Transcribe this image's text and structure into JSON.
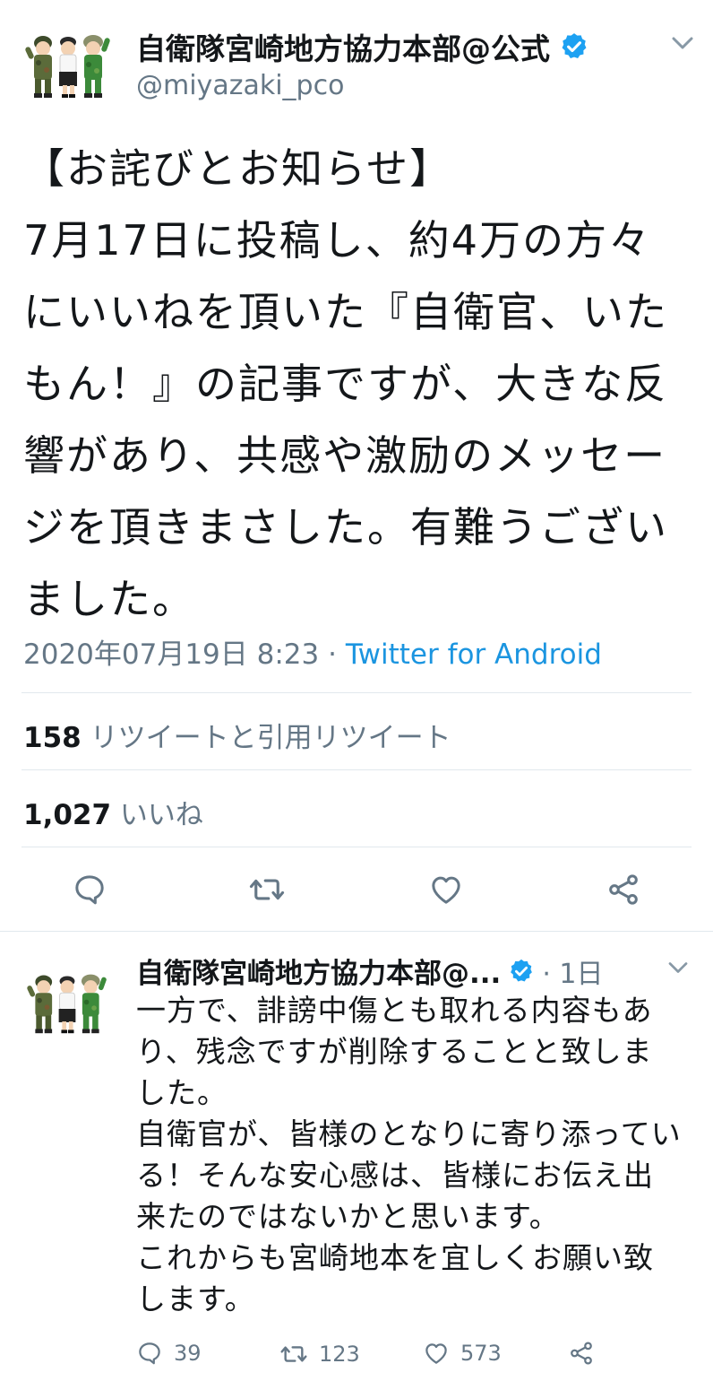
{
  "tweet": {
    "display_name": "自衛隊宮崎地方協力本部@公式",
    "handle": "@miyazaki_pco",
    "text": "【お詫びとお知らせ】\n7月17日に投稿し、約4万の方々にいいねを頂いた『自衛官、いたもん！』の記事ですが、大きな反響があり、共感や激励のメッセージを頂きまさした。有難うございました。",
    "timestamp": "2020年07月19日 8:23",
    "separator": " · ",
    "source": "Twitter for Android",
    "retweets_count": "158",
    "retweets_label": "リツイートと引用リツイート",
    "likes_count": "1,027",
    "likes_label": "いいね"
  },
  "reply": {
    "display_name": "自衛隊宮崎地方協力本部@...",
    "time": "· 1日",
    "text": "一方で、誹謗中傷とも取れる内容もあり、残念ですが削除することと致しました。\n自衛官が、皆様のとなりに寄り添っている！そんな安心感は、皆様にお伝え出来たのではないかと思います。\nこれからも宮崎地本を宜しくお願い致します。",
    "replies_count": "39",
    "retweets_count": "123",
    "likes_count": "573"
  },
  "colors": {
    "accent": "#1b95e0",
    "muted": "#657786",
    "divider": "#e1e8ed",
    "verified": "#1da1f2"
  }
}
